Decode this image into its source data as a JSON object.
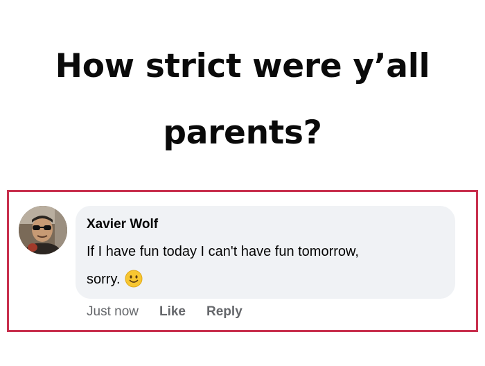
{
  "headline": {
    "line1": "How strict were y’all",
    "line2": "parents?"
  },
  "comment": {
    "author": "Xavier Wolf",
    "text_line1": "If I have fun today I can't have fun tomorrow,",
    "text_line2": "sorry.",
    "emoji": "slightly-smiling-face-icon",
    "timestamp": "Just now",
    "like_label": "Like",
    "reply_label": "Reply"
  },
  "colors": {
    "frame_border": "#c8304e",
    "bubble_bg": "#f0f2f5",
    "meta_text": "#65676b",
    "emoji_yellow": "#f7c631"
  }
}
